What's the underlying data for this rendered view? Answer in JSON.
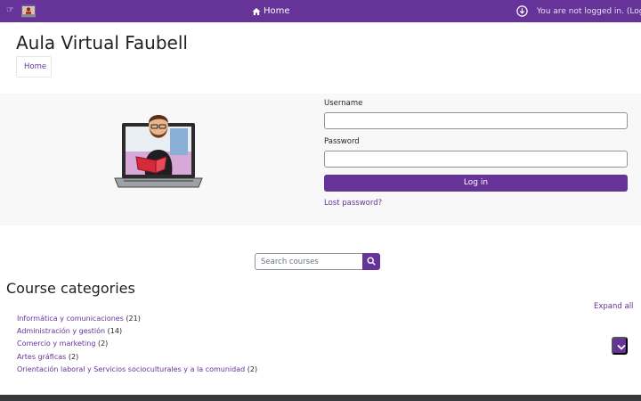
{
  "navbar": {
    "home_label": "Home",
    "login_text": "You are not logged in. (",
    "login_link": "Log in",
    "login_close": ")",
    "icons": {
      "menu": "hand-pointer-icon",
      "logo": "site-logo-icon",
      "home": "home-icon",
      "download": "download-circle-icon"
    }
  },
  "header": {
    "site_title": "Aula Virtual Faubell",
    "breadcrumb": "Home"
  },
  "login": {
    "username_label": "Username",
    "username_value": "",
    "password_label": "Password",
    "password_value": "",
    "button_label": "Log in",
    "lost_password": "Lost password?"
  },
  "search": {
    "placeholder": "Search courses",
    "icon": "search-icon"
  },
  "categories": {
    "title": "Course categories",
    "expand_all": "Expand all",
    "items": [
      {
        "name": "Informática y comunicaciones",
        "count": "(21)"
      },
      {
        "name": "Administración y gestión",
        "count": "(14)"
      },
      {
        "name": "Comercio y marketing",
        "count": "(2)"
      },
      {
        "name": "Artes gráficas",
        "count": "(2)"
      },
      {
        "name": "Orientación laboral y Servicios socioculturales y a la comunidad",
        "count": "(2)"
      }
    ]
  },
  "colors": {
    "brand": "#663399",
    "footer": "#373a3c",
    "panel": "#f8f8f9"
  }
}
